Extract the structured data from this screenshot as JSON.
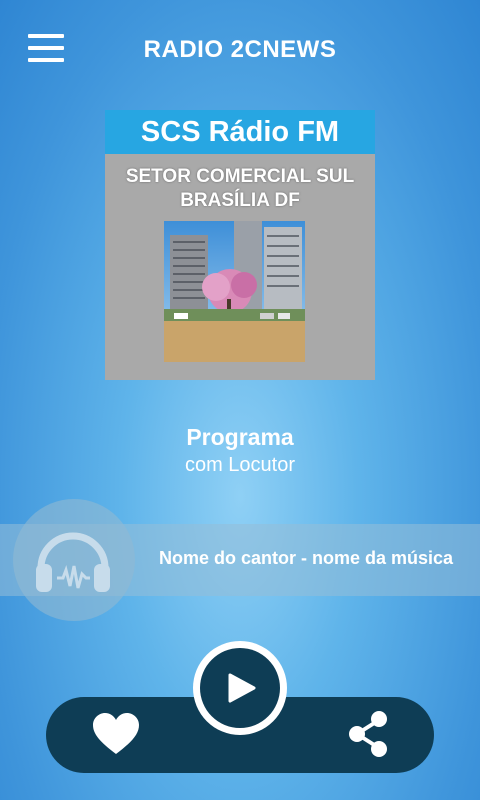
{
  "header": {
    "title": "RADIO 2CNEWS",
    "menu_icon": "hamburger-menu-icon"
  },
  "cover": {
    "station_name": "SCS Rádio FM",
    "subtitle_line1": "SETOR COMERCIAL SUL",
    "subtitle_line2": "BRASÍLIA DF",
    "header_color": "#27a6e2"
  },
  "program": {
    "name": "Programa",
    "host": "com Locutor"
  },
  "now_playing": {
    "text": "Nome do cantor - nome da música",
    "icon": "headphones-icon"
  },
  "controls": {
    "favorite_icon": "heart-icon",
    "play_icon": "play-icon",
    "share_icon": "share-icon",
    "bar_color": "#0e3d55"
  }
}
